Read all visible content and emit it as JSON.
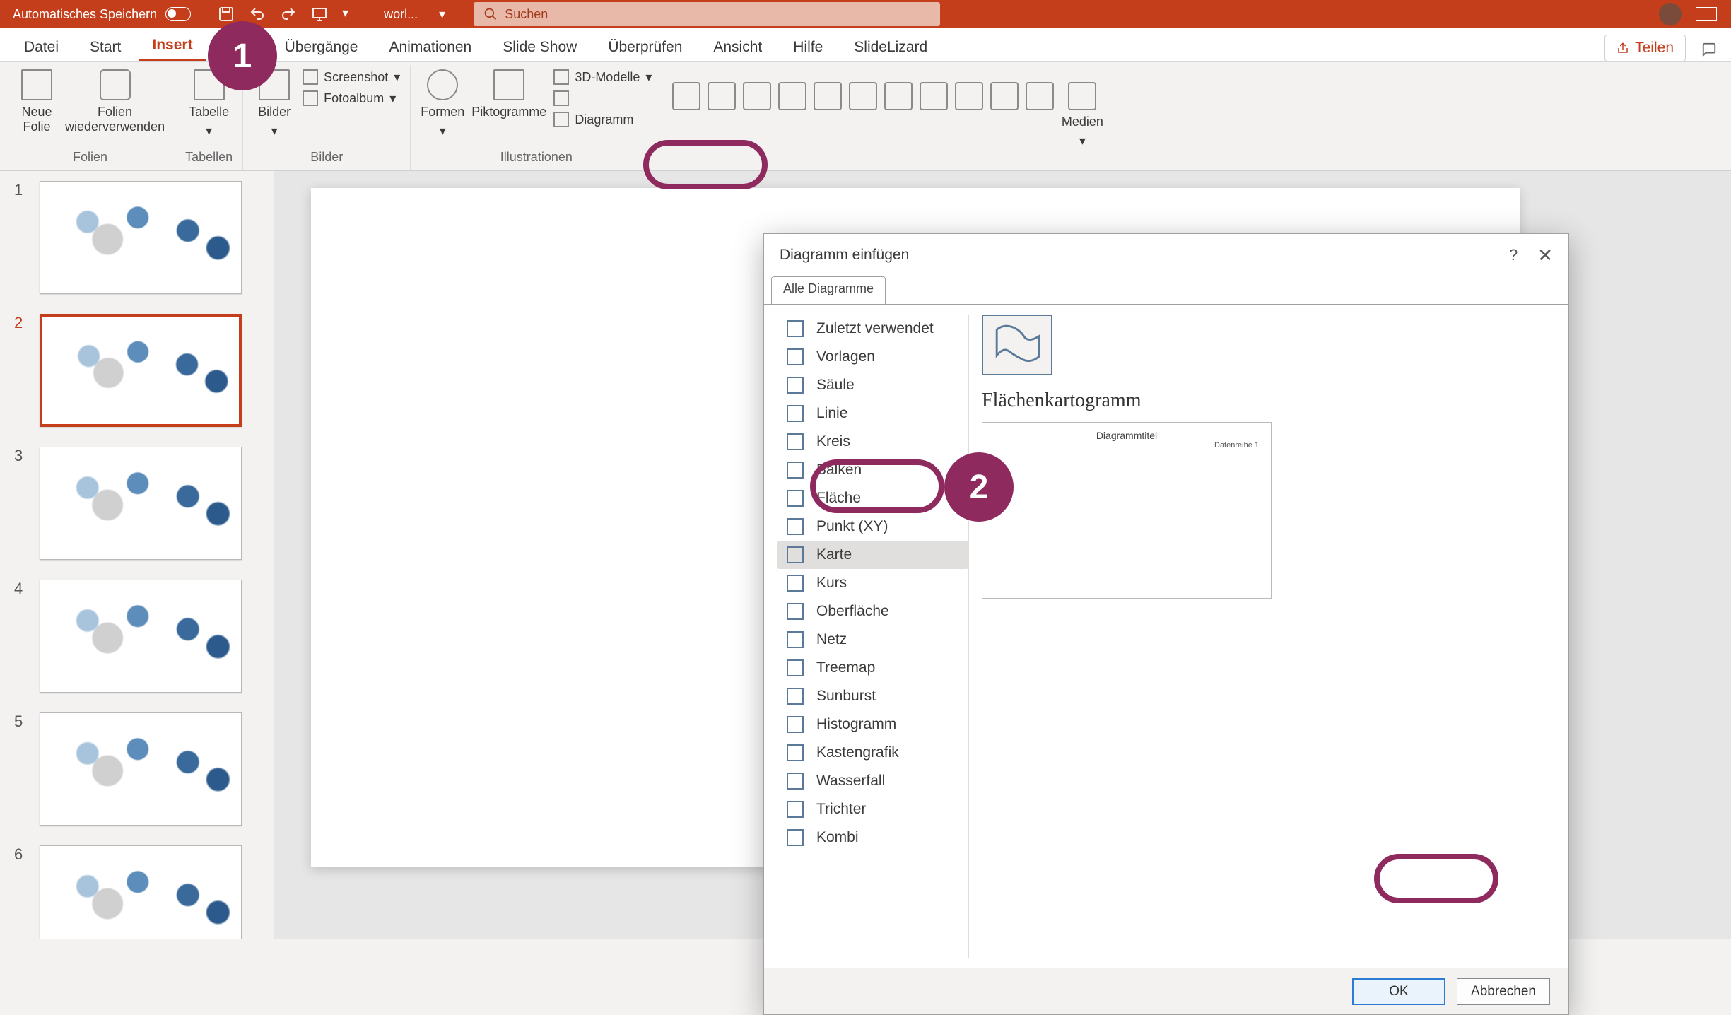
{
  "titlebar": {
    "autosave": "Automatisches Speichern",
    "filename": "worl...",
    "search_placeholder": "Suchen"
  },
  "tabs": {
    "datei": "Datei",
    "start": "Start",
    "insert": "Insert",
    "uebergaenge": "Übergänge",
    "animationen": "Animationen",
    "slideshow": "Slide Show",
    "ueberpruefen": "Überprüfen",
    "ansicht": "Ansicht",
    "hilfe": "Hilfe",
    "slidelizard": "SlideLizard",
    "teilen": "Teilen"
  },
  "ribbon": {
    "neue_folie": "Neue\nFolie",
    "folien_wieder": "Folien\nwiederverwenden",
    "grp_folien": "Folien",
    "tabelle": "Tabelle",
    "grp_tabellen": "Tabellen",
    "bilder": "Bilder",
    "screenshot": "Screenshot",
    "fotoalbum": "Fotoalbum",
    "grp_bilder": "Bilder",
    "formen": "Formen",
    "piktogramme": "Piktogramme",
    "3dmodelle": "3D-Modelle",
    "diagramm": "Diagramm",
    "grp_illustrationen": "Illustrationen",
    "medien": "Medien"
  },
  "dialog": {
    "title": "Diagramm einfügen",
    "tab_all": "Alle Diagramme",
    "categories": [
      "Zuletzt verwendet",
      "Vorlagen",
      "Säule",
      "Linie",
      "Kreis",
      "Balken",
      "Fläche",
      "Punkt (XY)",
      "Karte",
      "Kurs",
      "Oberfläche",
      "Netz",
      "Treemap",
      "Sunburst",
      "Histogramm",
      "Kastengrafik",
      "Wasserfall",
      "Trichter",
      "Kombi"
    ],
    "selected_index": 8,
    "subtype_heading": "Flächenkartogramm",
    "preview_title": "Diagrammtitel",
    "preview_legend": "Datenreihe 1",
    "ok": "OK",
    "cancel": "Abbrechen"
  },
  "annotations": {
    "a1": "1",
    "a2": "2"
  },
  "slides": [
    {
      "num": "1"
    },
    {
      "num": "2"
    },
    {
      "num": "3"
    },
    {
      "num": "4"
    },
    {
      "num": "5"
    },
    {
      "num": "6"
    }
  ],
  "active_slide_index": 1
}
